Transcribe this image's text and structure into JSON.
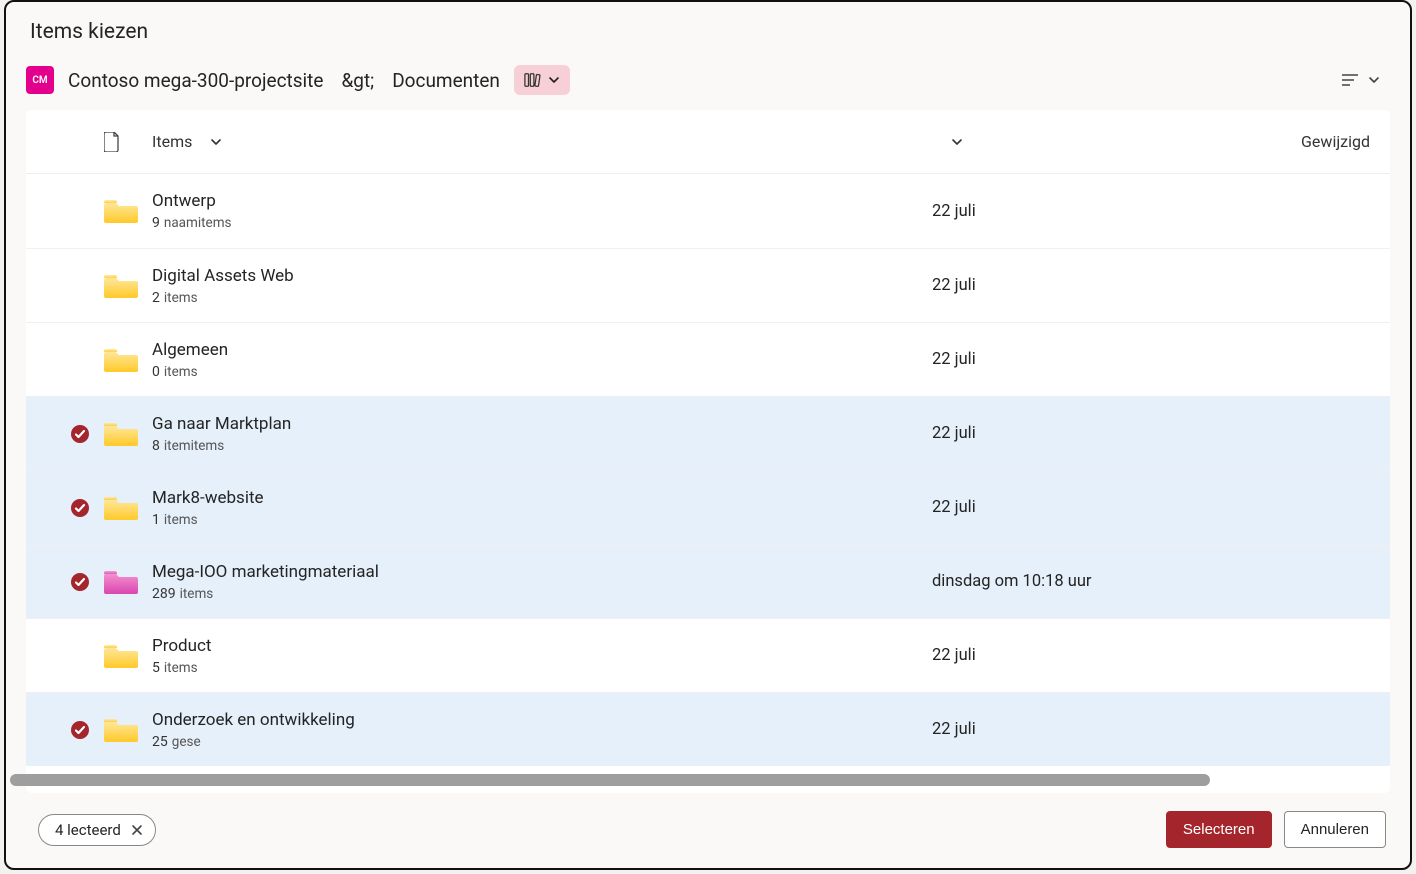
{
  "dialog": {
    "title": "Items kiezen"
  },
  "breadcrumb": {
    "site_initials": "CM",
    "site": "Contoso mega-300-projectsite",
    "sep": "&gt;",
    "library": "Documenten"
  },
  "columns": {
    "name": "Items",
    "modified": "Gewijzigd"
  },
  "items": [
    {
      "name": "Ontwerp",
      "count": "9",
      "count_label": "naamitems",
      "modified": "22 juli",
      "selected": false,
      "color": "yellow"
    },
    {
      "name": "Digital Assets Web",
      "count": "2",
      "count_label": "items",
      "modified": "22 juli",
      "selected": false,
      "color": "yellow"
    },
    {
      "name": "Algemeen",
      "count": "0",
      "count_label": "items",
      "modified": "22 juli",
      "selected": false,
      "color": "yellow"
    },
    {
      "name": "Ga naar Marktplan",
      "count": "8",
      "count_label": "itemitems",
      "modified": "22 juli",
      "selected": true,
      "color": "yellow"
    },
    {
      "name": "Mark8-website",
      "count": "1",
      "count_label": "items",
      "modified": "22 juli",
      "selected": true,
      "color": "yellow"
    },
    {
      "name": "Mega-IOO marketingmateriaal",
      "count": "289",
      "count_label": "items",
      "modified": "dinsdag om 10:18 uur",
      "selected": true,
      "color": "magenta"
    },
    {
      "name": "Product",
      "count": "5",
      "count_label": "items",
      "modified": "22 juli",
      "selected": false,
      "color": "yellow"
    },
    {
      "name": "Onderzoek en ontwikkeling",
      "count": "25",
      "count_label": "gese",
      "modified": "22 juli",
      "selected": true,
      "color": "yellow"
    }
  ],
  "footer": {
    "selection_text": "4 lecteerd",
    "select": "Selecteren",
    "cancel": "Annuleren"
  }
}
